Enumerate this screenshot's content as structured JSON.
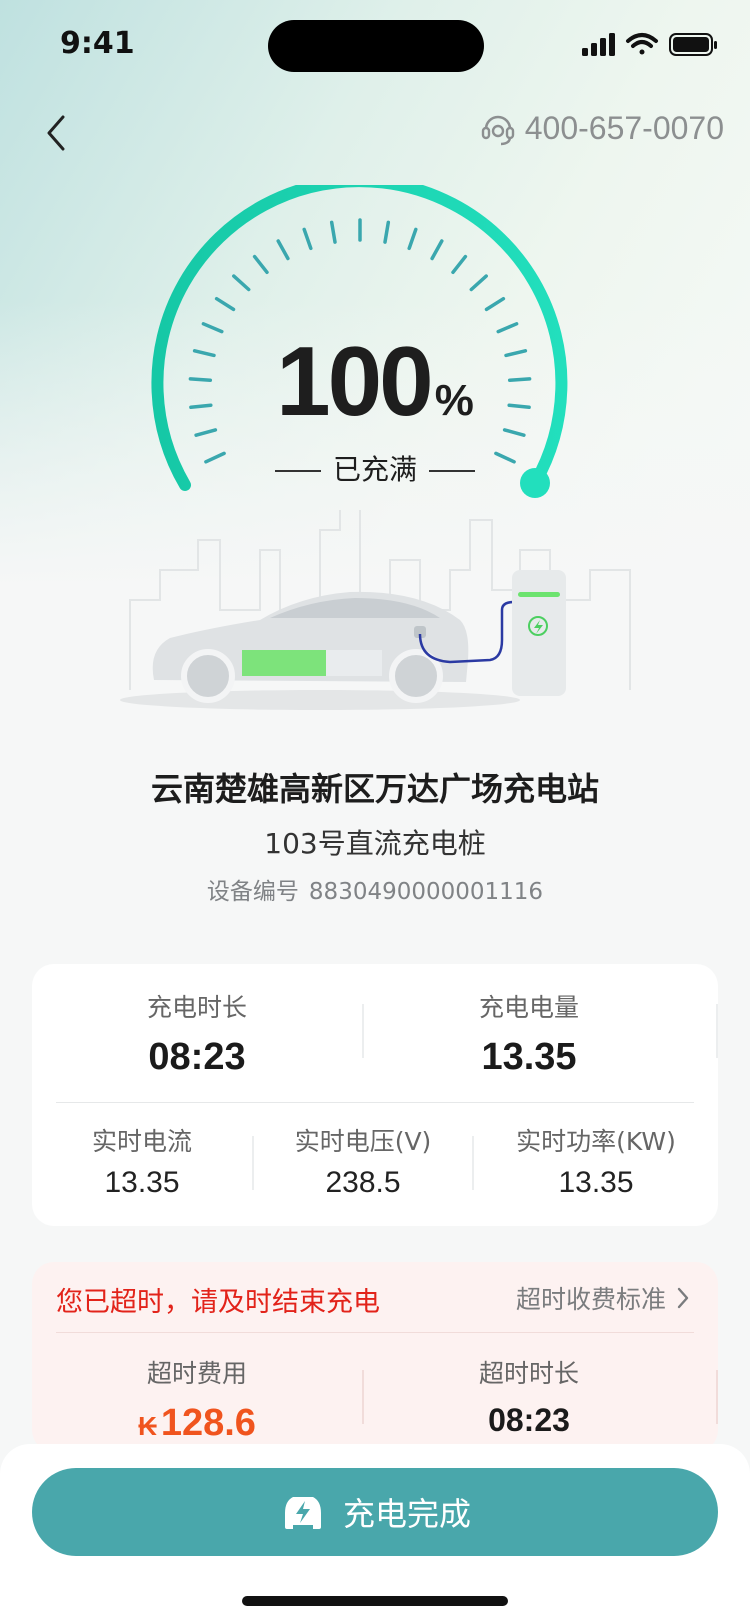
{
  "status_bar": {
    "time": "9:41"
  },
  "header": {
    "service_phone": "400-657-0070"
  },
  "gauge": {
    "percent": "100",
    "unit": "%",
    "status": "已充满",
    "level": 1.0
  },
  "station": {
    "name": "云南楚雄高新区万达广场充电站",
    "pile": "103号直流充电桩",
    "device_label": "设备编号",
    "device_id": "8830490000001116"
  },
  "stats": {
    "duration_label": "充电时长",
    "duration": "08:23",
    "energy_label": "充电电量",
    "energy": "13.35",
    "current_label": "实时电流",
    "current": "13.35",
    "voltage_label": "实时电压(V)",
    "voltage": "238.5",
    "power_label": "实时功率(KW)",
    "power": "13.35"
  },
  "overtime": {
    "warning": "您已超时，请及时结束充电",
    "rules_link": "超时收费标准",
    "fee_label": "超时费用",
    "currency": "₭",
    "fee": "128.6",
    "time_label": "超时时长",
    "time": "08:23"
  },
  "action": {
    "label": "充电完成"
  },
  "colors": {
    "accent": "#1fd6b5",
    "button": "#49a7ab",
    "warning": "#e2231a",
    "fee": "#f0541e"
  }
}
